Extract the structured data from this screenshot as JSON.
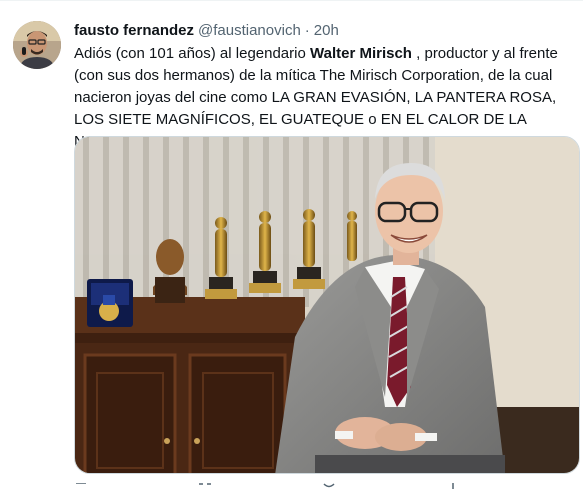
{
  "tweet": {
    "author_name": "fausto fernandez",
    "handle": "@faustianovich",
    "separator": "·",
    "time": "20h",
    "text_part1": "Adiós (con 101 años) al legendario ",
    "text_bold": "Walter Mirisch",
    "text_part2": " , productor y al frente (con sus dos hermanos) de la mítica The Mirisch Corporation, de la cual nacieron joyas del cine como LA GRAN EVASIÓN, LA PANTERA ROSA, LOS SIETE MAGNÍFICOS, EL GUATEQUE o EN EL CALOR DE LA NOCHE."
  },
  "icons": {
    "avatar": "avatar-image",
    "reply": "reply-icon",
    "retweet": "retweet-icon",
    "like": "heart-icon",
    "share": "share-icon"
  },
  "colors": {
    "text": "#0f1419",
    "secondary": "#536471",
    "border": "#cfd9de"
  }
}
